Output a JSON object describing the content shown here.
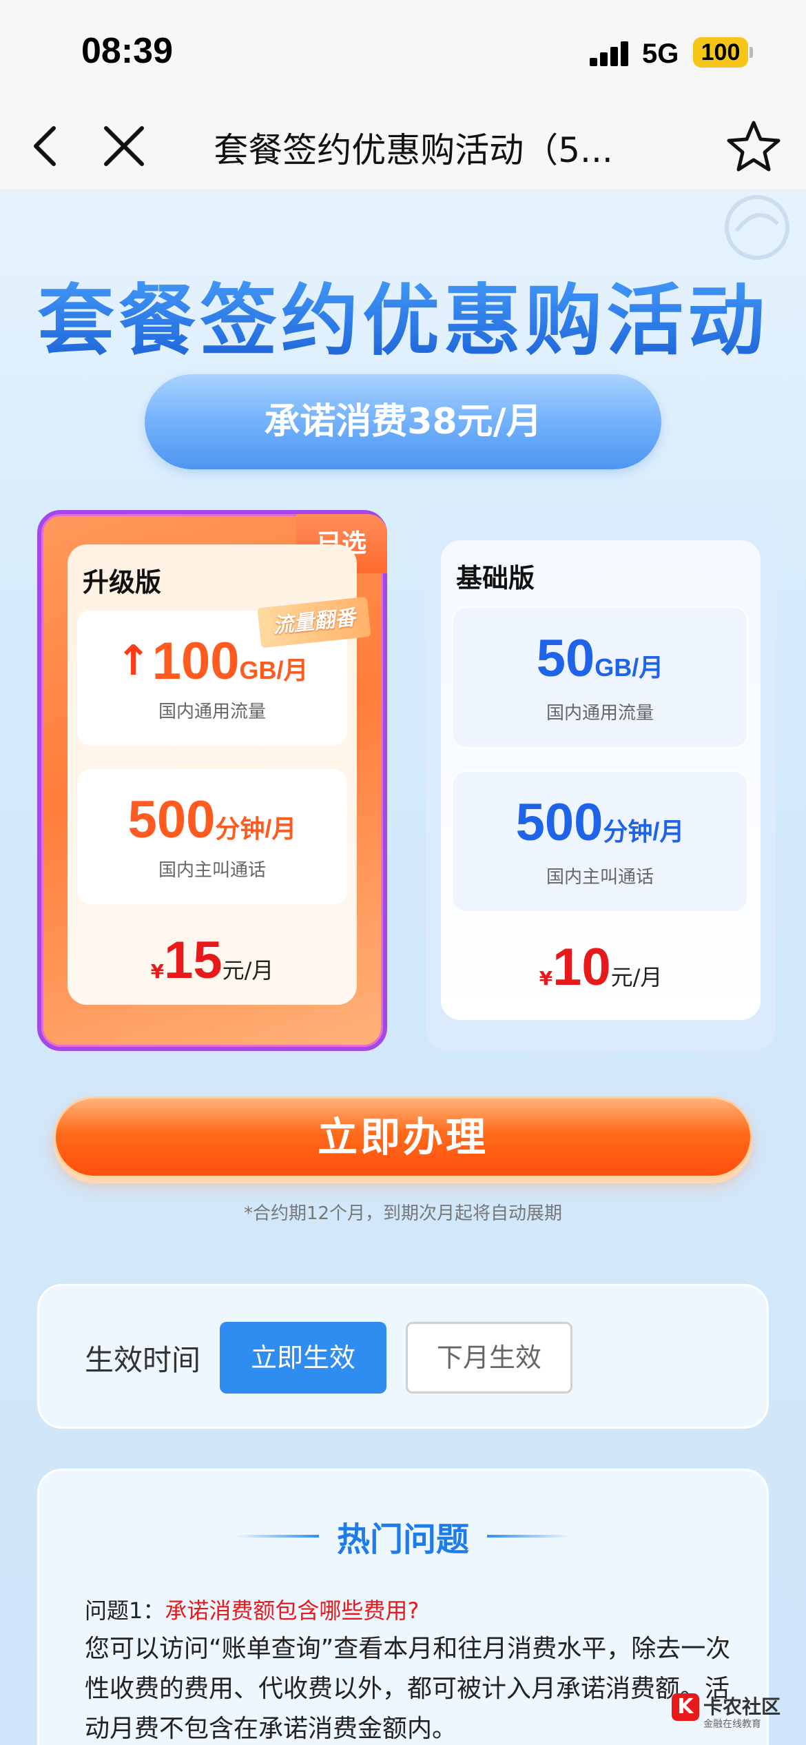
{
  "status_bar": {
    "time": "08:39",
    "network": "5G",
    "battery": "100"
  },
  "nav": {
    "title": "套餐签约优惠购活动（5..."
  },
  "hero": {
    "title": "套餐签约优惠购活动",
    "promise": "承诺消费38元/月"
  },
  "plans": [
    {
      "name": "升级版",
      "badge": "已选",
      "tag": "流量翻番",
      "data": {
        "value": "100",
        "unit": "GB/月",
        "label": "国内通用流量"
      },
      "voice": {
        "value": "500",
        "unit": "分钟/月",
        "label": "国内主叫通话"
      },
      "price": {
        "currency": "¥",
        "value": "15",
        "unit": "元/月"
      }
    },
    {
      "name": "基础版",
      "data": {
        "value": "50",
        "unit": "GB/月",
        "label": "国内通用流量"
      },
      "voice": {
        "value": "500",
        "unit": "分钟/月",
        "label": "国内主叫通话"
      },
      "price": {
        "currency": "¥",
        "value": "10",
        "unit": "元/月"
      }
    }
  ],
  "cta": {
    "label": "立即办理",
    "note": "*合约期12个月，到期次月起将自动展期"
  },
  "effective_time": {
    "label": "生效时间",
    "options": [
      "立即生效",
      "下月生效"
    ],
    "selected": "立即生效"
  },
  "faq": {
    "title": "热门问题",
    "items": [
      {
        "q_prefix": "问题1：",
        "question": "承诺消费额包含哪些费用?",
        "answer": "您可以访问“账单查询”查看本月和往月消费水平，除去一次性收费的费用、代收费以外，都可被计入月承诺消费额。活动月费不包含在承诺消费金额内。"
      }
    ]
  },
  "watermark": {
    "logo": "K",
    "title": "卡农社区",
    "subtitle": "金融在线教育"
  },
  "colors": {
    "accent_blue": "#2f8cf1",
    "accent_orange": "#ff6a1a",
    "price_red": "#e8191b"
  }
}
